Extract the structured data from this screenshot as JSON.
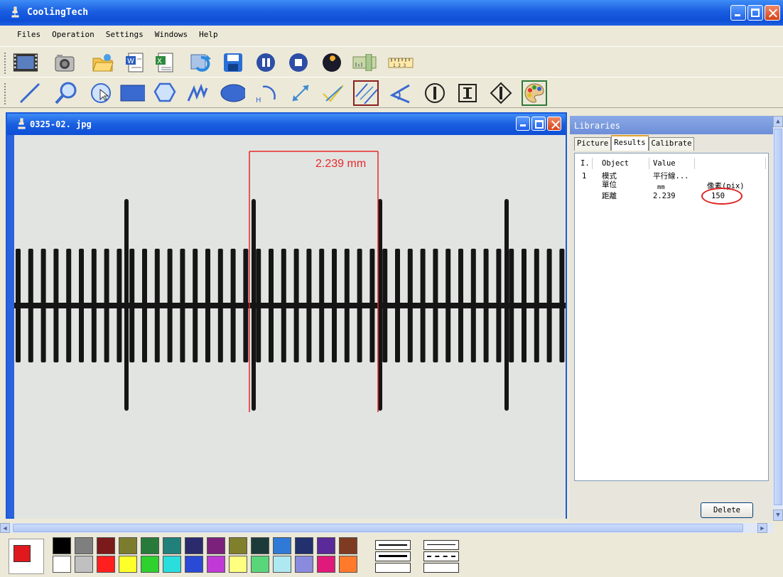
{
  "app": {
    "title": "CoolingTech"
  },
  "menu": [
    "Files",
    "Operation",
    "Settings",
    "Windows",
    "Help"
  ],
  "toolbar1": [
    "video-camera-icon",
    "camera-icon",
    "open-folder-icon",
    "word-export-icon",
    "excel-export-icon",
    "refresh-icon",
    "save-icon",
    "pause-icon",
    "stop-icon",
    "wrench-icon",
    "vertical-ruler-icon",
    "horizontal-ruler-icon"
  ],
  "toolbar2": [
    "line-tool-icon",
    "zoom-tool-icon",
    "select-tool-icon",
    "rectangle-tool-icon",
    "polygon-tool-icon",
    "curve-tool-icon",
    "ellipse-tool-icon",
    "arc-tool-icon",
    "distance-tool-icon",
    "angle-line-tool-icon",
    "parallel-line-tool-icon",
    "angle-tool-icon",
    "circle-center-tool-icon",
    "vertical-measure-tool-icon",
    "diamond-measure-tool-icon",
    "color-palette-icon"
  ],
  "image_window": {
    "title": "0325-02. jpg",
    "measurement_label": "2.239  mm"
  },
  "libraries": {
    "title": "Libraries",
    "tabs": [
      "Picture",
      "Results",
      "Calibrate"
    ],
    "active_tab": "Results",
    "columns": [
      "I.",
      "Object",
      "Value"
    ],
    "rows": [
      {
        "index": "1",
        "object": "模式",
        "value": "平行線..."
      },
      {
        "index": "",
        "object": "單位",
        "value": "mm",
        "extra": "像素(pix)"
      },
      {
        "index": "",
        "object": "距離",
        "value": "2.239",
        "extra": "150"
      }
    ],
    "delete_label": "Delete"
  },
  "palette": {
    "current_color": "#e0191f",
    "top": [
      "#000000",
      "#7f7f7f",
      "#7b1a1a",
      "#7c7c2e",
      "#287a3a",
      "#22807a",
      "#2a2a6c",
      "#7b207b",
      "#7f7f2c",
      "#1d3a3a",
      "#2f7ad6",
      "#22306e",
      "#5a2a9a",
      "#7f3a22"
    ],
    "bottom": [
      "#ffffff",
      "#c0c0c0",
      "#ff1f1f",
      "#ffff2a",
      "#2ed12e",
      "#2adede",
      "#2a4ad6",
      "#c03ad6",
      "#ffff80",
      "#5ad67a",
      "#aee8f0",
      "#8a8adf",
      "#e01a7a",
      "#ff7a2a"
    ]
  }
}
